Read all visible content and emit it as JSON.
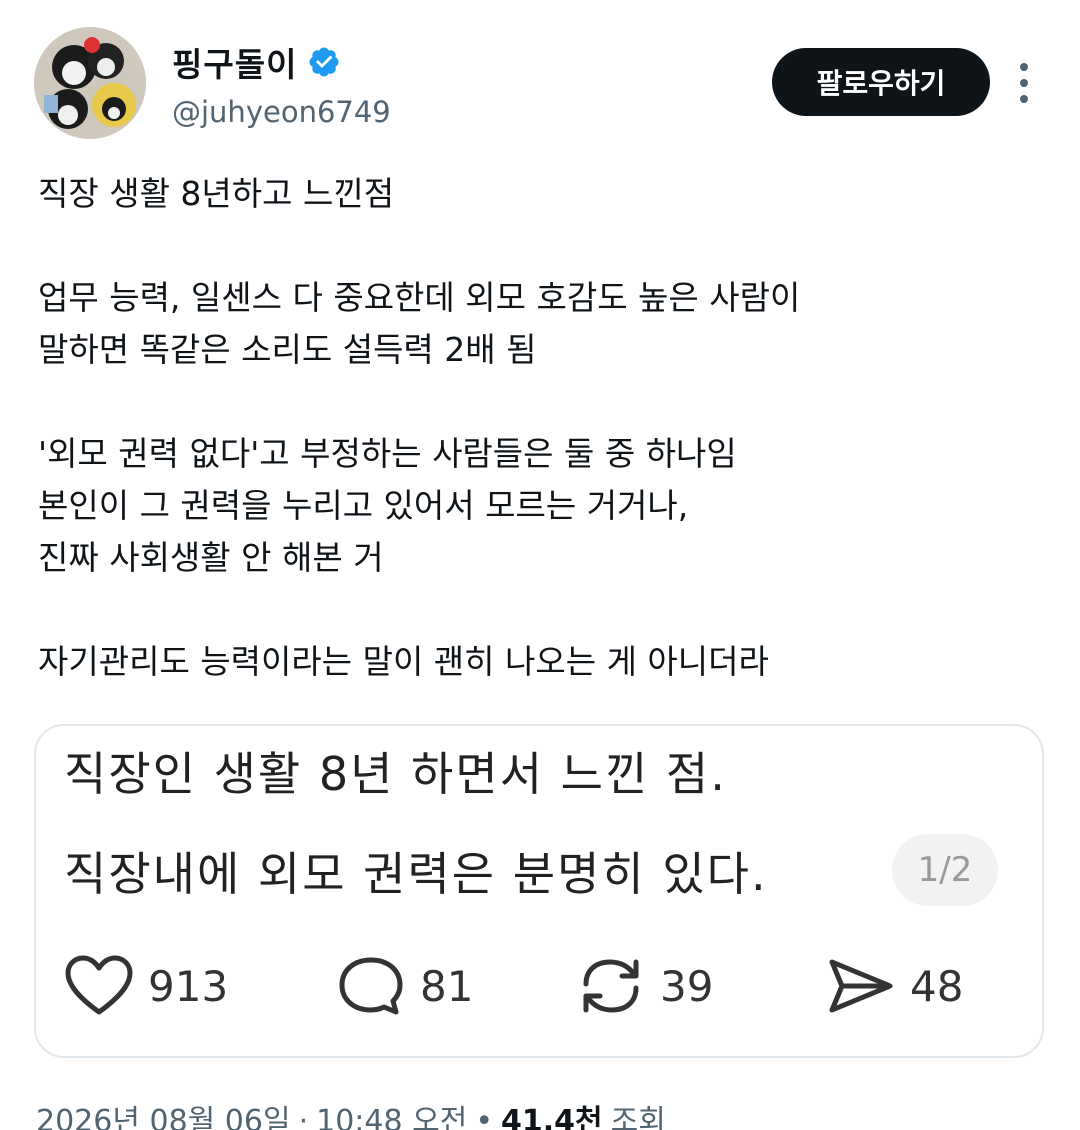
{
  "author": {
    "display_name": "핑구돌이",
    "handle": "@juhyeon6749",
    "verified": true,
    "verified_color": "#1d9bf0"
  },
  "header": {
    "follow_label": "팔로우하기",
    "more_icon": "more-vertical-icon"
  },
  "tweet": {
    "lines": [
      "직장 생활 8년하고 느낀점",
      "",
      "업무 능력, 일센스 다 중요한데 외모 호감도 높은 사람이",
      "말하면 똑같은 소리도 설득력 2배 됨",
      "",
      "'외모 권력 없다'고 부정하는 사람들은 둘 중 하나임",
      "본인이 그 권력을 누리고 있어서 모르는 거거나,",
      "진짜 사회생활 안 해본 거",
      "",
      "자기관리도 능력이라는 말이 괜히 나오는 게 아니더라"
    ]
  },
  "embedded_image": {
    "line1": "직장인 생활 8년 하면서 느낀 점.",
    "line2": "직장내에 외모 권력은 분명히 있다.",
    "page_indicator": "1/2",
    "likes": "913",
    "comments": "81",
    "reposts": "39",
    "shares": "48"
  },
  "meta": {
    "date": "2026년 08월 06일",
    "separator": "·",
    "time": "10:48 오전",
    "bullet": "•",
    "views_count": "41.4천",
    "views_label": "조회"
  }
}
